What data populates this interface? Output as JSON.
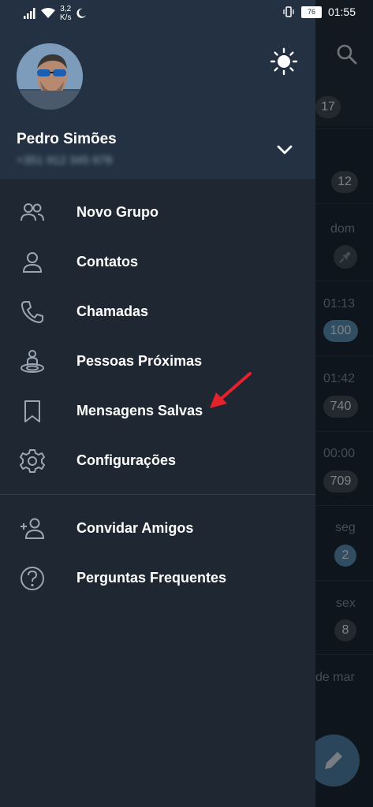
{
  "status_bar": {
    "speed_value": "3,2",
    "speed_unit": "K/s",
    "battery": "76",
    "time": "01:55"
  },
  "background_chat_list": {
    "top_badge": "17",
    "rows": [
      {
        "time": "",
        "badge": "12",
        "badge_style": "muted"
      },
      {
        "time": "dom",
        "badge": "",
        "badge_style": "pin"
      },
      {
        "time": "01:13",
        "badge": "100",
        "badge_style": "blue"
      },
      {
        "time": "01:42",
        "badge": "740",
        "badge_style": "muted"
      },
      {
        "time": "00:00",
        "badge": "709",
        "badge_style": "muted"
      },
      {
        "time": "seg",
        "badge": "2",
        "badge_style": "blue"
      },
      {
        "time": "sex",
        "badge": "8",
        "badge_style": "muted"
      },
      {
        "time": "de mar",
        "badge": "",
        "badge_style": "none"
      }
    ]
  },
  "drawer": {
    "user": {
      "name": "Pedro Simões",
      "phone": "+351 912 345 678"
    },
    "menu_items": [
      {
        "label": "Novo Grupo",
        "icon": "group-icon"
      },
      {
        "label": "Contatos",
        "icon": "person-icon"
      },
      {
        "label": "Chamadas",
        "icon": "phone-icon"
      },
      {
        "label": "Pessoas Próximas",
        "icon": "nearby-people-icon"
      },
      {
        "label": "Mensagens Salvas",
        "icon": "bookmark-icon"
      },
      {
        "label": "Configurações",
        "icon": "gear-icon"
      }
    ],
    "secondary_items": [
      {
        "label": "Convidar Amigos",
        "icon": "add-person-icon"
      },
      {
        "label": "Perguntas Frequentes",
        "icon": "question-icon"
      }
    ]
  },
  "colors": {
    "drawer_bg": "#1e2732",
    "header_bg": "#233142",
    "accent_blue": "#5a8db1",
    "annotation_arrow": "#e5222b"
  }
}
